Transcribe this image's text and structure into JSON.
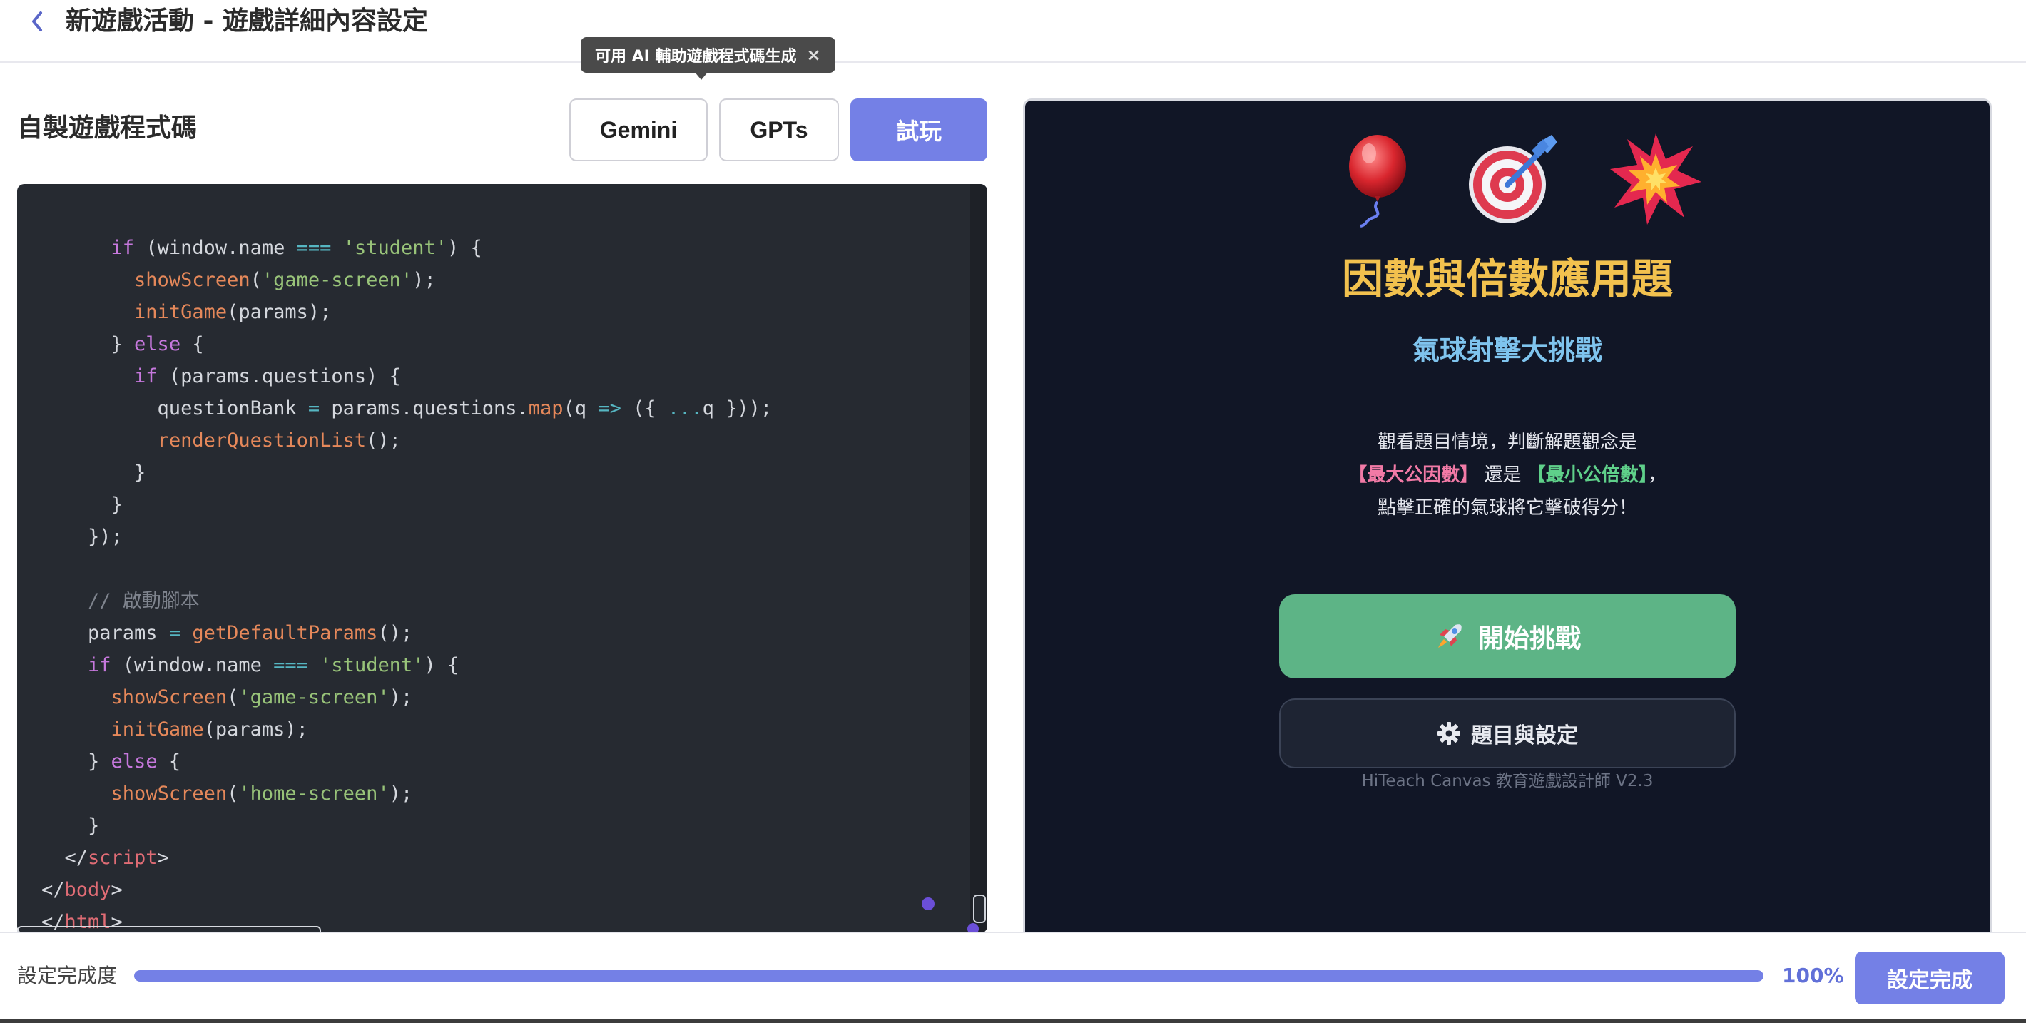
{
  "header": {
    "title": "新遊戲活動 - 遊戲詳細內容設定",
    "back_icon": "chevron-left-icon"
  },
  "tooltip": {
    "text": "可用 AI 輔助遊戲程式碼生成",
    "close_glyph": "×"
  },
  "editor_panel": {
    "title": "自製遊戲程式碼",
    "buttons": {
      "gemini": "Gemini",
      "gpts": "GPTs",
      "try": "試玩"
    },
    "code": {
      "comment_start": "// 啟動腳本"
    }
  },
  "preview": {
    "emojis": [
      "balloon-icon",
      "target-icon",
      "explosion-icon"
    ],
    "title": "因數與倍數應用題",
    "subtitle": "氣球射擊大挑戰",
    "desc_line1": "觀看題目情境，判斷解題觀念是",
    "desc_gcf": "【最大公因數】",
    "desc_or": " 還是 ",
    "desc_lcm": "【最小公倍數】",
    "desc_comma": "，",
    "desc_line3": "點擊正確的氣球將它擊破得分！",
    "start_label": "開始挑戰",
    "settings_label": "題目與設定",
    "footer": "HiTeach Canvas 教育遊戲設計師 V2.3"
  },
  "bottom": {
    "progress_label": "設定完成度",
    "progress_value": "100%",
    "progress_fraction": 1.0,
    "done_label": "設定完成"
  },
  "colors": {
    "accent": "#7480e6",
    "start_green": "#5db486",
    "title_gold": "#f2c14e",
    "subtitle_blue": "#7fc4ee"
  }
}
